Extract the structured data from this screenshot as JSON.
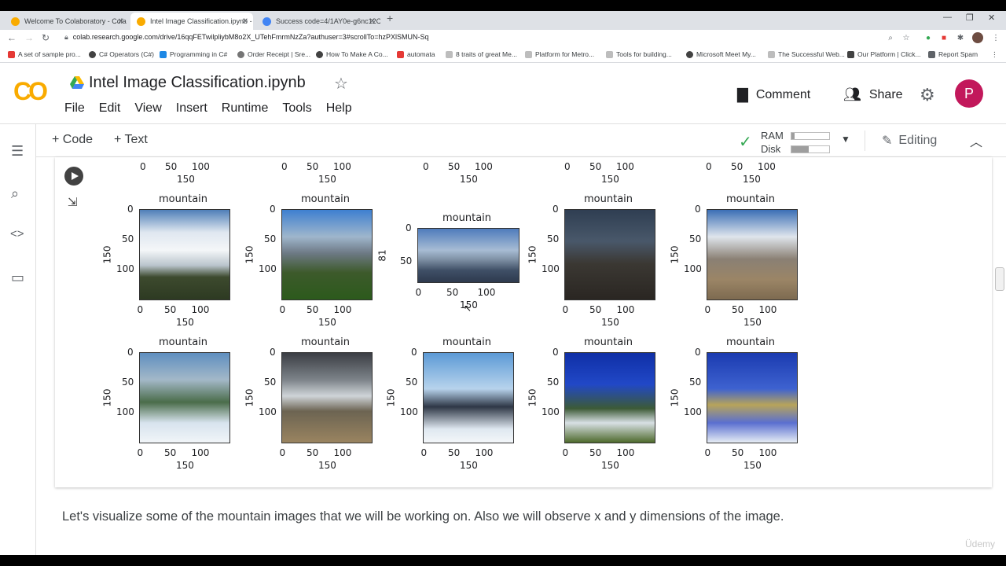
{
  "browser": {
    "tabs": [
      {
        "title": "Welcome To Colaboratory - Cola",
        "active": false
      },
      {
        "title": "Intel Image Classification.ipynb -",
        "active": true
      },
      {
        "title": "Success code=4/1AY0e-g6nc12C",
        "active": false
      }
    ],
    "url": "colab.research.google.com/drive/16qqFETwilpliybM8o2X_UTehFmrmNzZa?authuser=3#scrollTo=hzPXlSMUN-Sq",
    "bookmarks": [
      "A set of sample pro...",
      "C# Operators (C#)",
      "Programming in C#",
      "Order Receipt | Sre...",
      "How To Make A Co...",
      "automata",
      "8 traits of great Me...",
      "Platform for Metro...",
      "Tools for building...",
      "Microsoft Meet My...",
      "The Successful Web...",
      "Our Platform | Click...",
      "Report Spam"
    ]
  },
  "colab": {
    "logo": "CO",
    "notebook_title": "Intel Image Classification.ipynb",
    "menu": [
      "File",
      "Edit",
      "View",
      "Insert",
      "Runtime",
      "Tools",
      "Help"
    ],
    "comment_label": "Comment",
    "share_label": "Share",
    "avatar_letter": "P",
    "add_code": "+ Code",
    "add_text": "+ Text",
    "ram_label": "RAM",
    "disk_label": "Disk",
    "ram_usage": 0.08,
    "disk_usage": 0.45,
    "editing_label": "Editing",
    "markdown_text": "Let's visualize some of the mountain images that we will be working on. Also we will observe x and y dimensions of the image.",
    "watermark": "Üdemy"
  },
  "plots": {
    "top_partial_xticks": [
      "0",
      "50",
      "100"
    ],
    "top_partial_xlabel": "150",
    "row1": [
      {
        "title": "mountain",
        "yticks": [
          "0",
          "50",
          "100"
        ],
        "ylabel": "150",
        "xticks": [
          "0",
          "50",
          "100"
        ],
        "xlabel": "150",
        "scene": "clouds"
      },
      {
        "title": "mountain",
        "yticks": [
          "0",
          "50",
          "100"
        ],
        "ylabel": "150",
        "xticks": [
          "0",
          "50",
          "100"
        ],
        "xlabel": "150",
        "scene": "valley"
      },
      {
        "title": "mountain",
        "yticks": [
          "0",
          "50"
        ],
        "ylabel": "81",
        "xticks": [
          "0",
          "50",
          "100"
        ],
        "xlabel": "150",
        "scene": "wide"
      },
      {
        "title": "mountain",
        "yticks": [
          "0",
          "50",
          "100"
        ],
        "ylabel": "150",
        "xticks": [
          "0",
          "50",
          "100"
        ],
        "xlabel": "150",
        "scene": "dark"
      },
      {
        "title": "mountain",
        "yticks": [
          "0",
          "50",
          "100"
        ],
        "ylabel": "150",
        "xticks": [
          "0",
          "50",
          "100"
        ],
        "xlabel": "150",
        "scene": "trail"
      }
    ],
    "row2": [
      {
        "title": "mountain",
        "yticks": [
          "0",
          "50",
          "100"
        ],
        "ylabel": "150",
        "xticks": [
          "0",
          "50",
          "100"
        ],
        "xlabel": "150",
        "scene": "snowforest"
      },
      {
        "title": "mountain",
        "yticks": [
          "0",
          "50",
          "100"
        ],
        "ylabel": "150",
        "xticks": [
          "0",
          "50",
          "100"
        ],
        "xlabel": "150",
        "scene": "road"
      },
      {
        "title": "mountain",
        "yticks": [
          "0",
          "50",
          "100"
        ],
        "ylabel": "150",
        "xticks": [
          "0",
          "50",
          "100"
        ],
        "xlabel": "150",
        "scene": "cliff"
      },
      {
        "title": "mountain",
        "yticks": [
          "0",
          "50",
          "100"
        ],
        "ylabel": "150",
        "xticks": [
          "0",
          "50",
          "100"
        ],
        "xlabel": "150",
        "scene": "alpine"
      },
      {
        "title": "mountain",
        "yticks": [
          "0",
          "50",
          "100"
        ],
        "ylabel": "150",
        "xticks": [
          "0",
          "50",
          "100"
        ],
        "xlabel": "150",
        "scene": "bluesky"
      }
    ]
  },
  "colors": {
    "colab_orange": "#f9ab00",
    "avatar": "#c2185b",
    "check": "#34a853"
  }
}
